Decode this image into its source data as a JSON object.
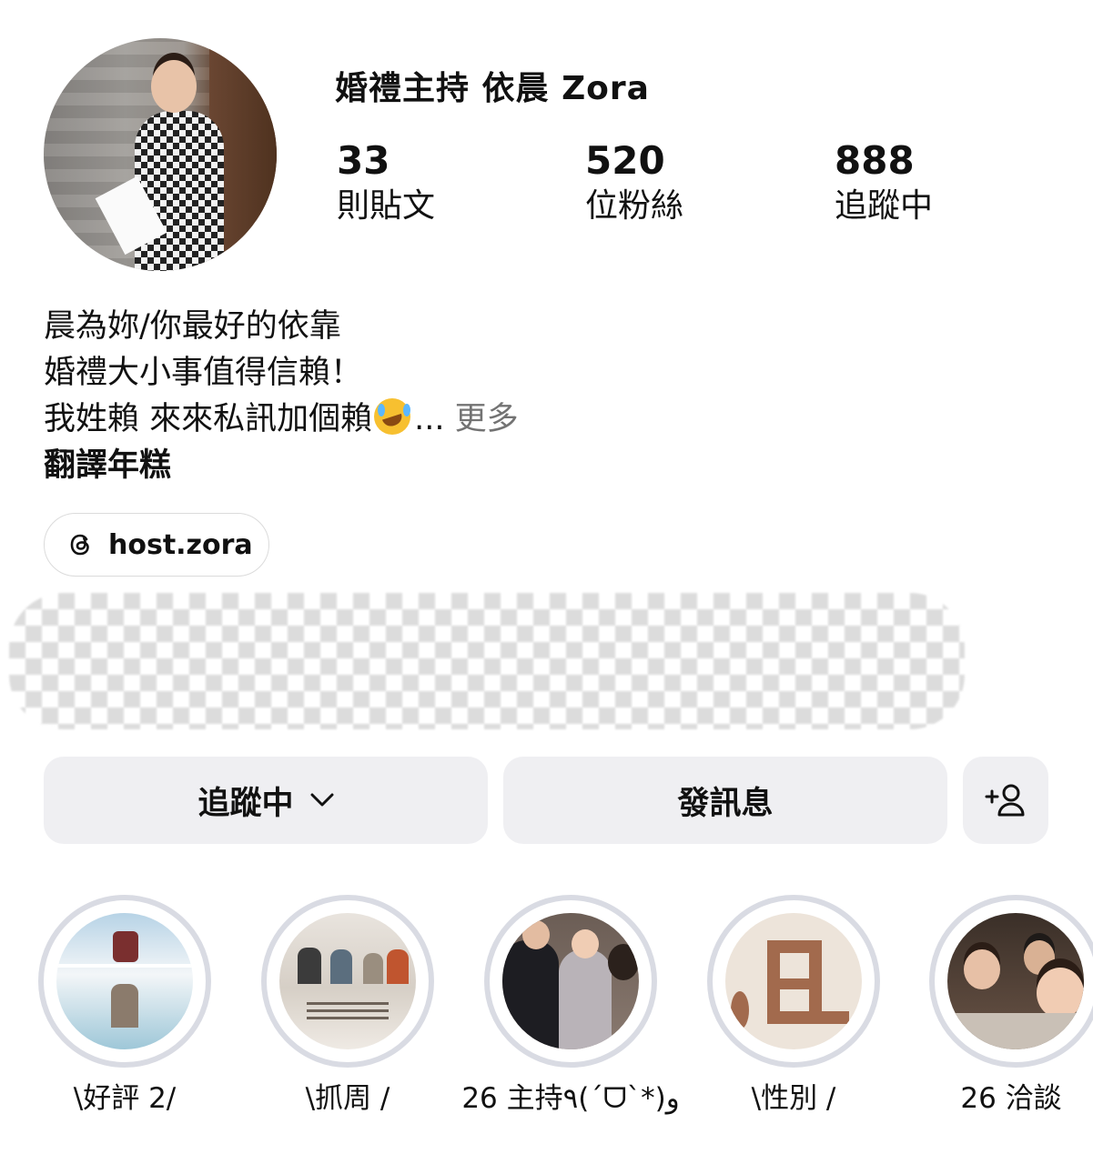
{
  "profile": {
    "display_name": "婚禮主持 依晨 Zora",
    "stats": [
      {
        "count": "33",
        "label": "則貼文"
      },
      {
        "count": "520",
        "label": "位粉絲"
      },
      {
        "count": "888",
        "label": "追蹤中"
      }
    ],
    "bio_lines": [
      "晨為妳/你最好的依靠",
      "婚禮大小事值得信賴！",
      "我姓賴 來來私訊加個賴"
    ],
    "bio_ellipsis": "...",
    "bio_more": "更多",
    "translate": "翻譯年糕",
    "link_handle": "host.zora"
  },
  "actions": {
    "following_label": "追蹤中",
    "message_label": "發訊息"
  },
  "highlights": [
    {
      "label": "\\好評 2/"
    },
    {
      "label": "\\抓周 /"
    },
    {
      "label": "26 主持٩(ˊᗜˋ*)و"
    },
    {
      "label": "\\性別 /"
    },
    {
      "label": "26 洽談"
    }
  ],
  "colors": {
    "button_bg": "#efeff2",
    "highlight_ring": "#d9dbe3",
    "muted_text": "#737373"
  },
  "icons": {
    "link": "threads-icon",
    "dropdown": "chevron-down-icon",
    "add_user": "add-person-icon",
    "bio_emoji": "rolling-laughing-emoji"
  }
}
